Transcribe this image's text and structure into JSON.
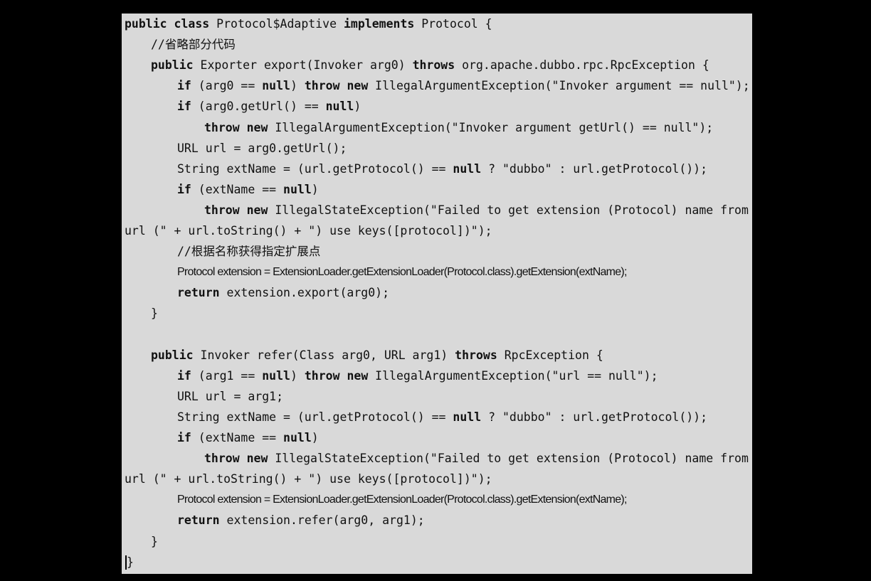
{
  "code": {
    "lines": [
      {
        "indent": 0,
        "segments": [
          {
            "t": "public class",
            "kw": true
          },
          {
            "t": " Protocol$Adaptive "
          },
          {
            "t": "implements",
            "kw": true
          },
          {
            "t": " Protocol {"
          }
        ]
      },
      {
        "indent": 1,
        "segments": [
          {
            "t": "//省略部分代码"
          }
        ]
      },
      {
        "indent": 1,
        "segments": [
          {
            "t": "public",
            "kw": true
          },
          {
            "t": " Exporter export(Invoker arg0) "
          },
          {
            "t": "throws",
            "kw": true
          },
          {
            "t": " org.apache.dubbo.rpc.RpcException {"
          }
        ]
      },
      {
        "indent": 2,
        "segments": [
          {
            "t": "if",
            "kw": true
          },
          {
            "t": " (arg0 == "
          },
          {
            "t": "null",
            "kw": true
          },
          {
            "t": ") "
          },
          {
            "t": "throw new",
            "kw": true
          },
          {
            "t": " IllegalArgumentException(\"Invoker argument == null\");"
          }
        ]
      },
      {
        "indent": 2,
        "segments": [
          {
            "t": "if",
            "kw": true
          },
          {
            "t": " (arg0.getUrl() == "
          },
          {
            "t": "null",
            "kw": true
          },
          {
            "t": ")"
          }
        ]
      },
      {
        "indent": 3,
        "segments": [
          {
            "t": "throw new",
            "kw": true
          },
          {
            "t": " IllegalArgumentException(\"Invoker argument getUrl() == null\");"
          }
        ]
      },
      {
        "indent": 2,
        "segments": [
          {
            "t": "URL url = arg0.getUrl();"
          }
        ]
      },
      {
        "indent": 2,
        "segments": [
          {
            "t": "String extName = (url.getProtocol() == "
          },
          {
            "t": "null",
            "kw": true
          },
          {
            "t": " ? \"dubbo\" : url.getProtocol());"
          }
        ]
      },
      {
        "indent": 2,
        "segments": [
          {
            "t": "if",
            "kw": true
          },
          {
            "t": " (extName == "
          },
          {
            "t": "null",
            "kw": true
          },
          {
            "t": ")"
          }
        ]
      },
      {
        "indent": 3,
        "segments": [
          {
            "t": "throw new",
            "kw": true
          },
          {
            "t": " IllegalStateException(\"Failed to get extension (Protocol) name from"
          }
        ]
      },
      {
        "indent": 0,
        "segments": [
          {
            "t": "url (\" + url.toString() + \") use keys([protocol])\");"
          }
        ]
      },
      {
        "indent": 2,
        "segments": [
          {
            "t": "//根据名称获得指定扩展点"
          }
        ]
      },
      {
        "indent": 2,
        "prop": true,
        "segments": [
          {
            "t": "Protocol extension = ExtensionLoader.getExtensionLoader(Protocol.class).getExtension(extName);"
          }
        ]
      },
      {
        "indent": 2,
        "segments": [
          {
            "t": "return",
            "kw": true
          },
          {
            "t": " extension.export(arg0);"
          }
        ]
      },
      {
        "indent": 1,
        "segments": [
          {
            "t": "}"
          }
        ]
      },
      {
        "indent": 0,
        "segments": []
      },
      {
        "indent": 1,
        "segments": [
          {
            "t": "public",
            "kw": true
          },
          {
            "t": " Invoker refer(Class arg0, URL arg1) "
          },
          {
            "t": "throws",
            "kw": true
          },
          {
            "t": " RpcException {"
          }
        ]
      },
      {
        "indent": 2,
        "segments": [
          {
            "t": "if",
            "kw": true
          },
          {
            "t": " (arg1 == "
          },
          {
            "t": "null",
            "kw": true
          },
          {
            "t": ") "
          },
          {
            "t": "throw new",
            "kw": true
          },
          {
            "t": " IllegalArgumentException(\"url == null\");"
          }
        ]
      },
      {
        "indent": 2,
        "segments": [
          {
            "t": "URL url = arg1;"
          }
        ]
      },
      {
        "indent": 2,
        "segments": [
          {
            "t": "String extName = (url.getProtocol() == "
          },
          {
            "t": "null",
            "kw": true
          },
          {
            "t": " ? \"dubbo\" : url.getProtocol());"
          }
        ]
      },
      {
        "indent": 2,
        "segments": [
          {
            "t": "if",
            "kw": true
          },
          {
            "t": " (extName == "
          },
          {
            "t": "null",
            "kw": true
          },
          {
            "t": ")"
          }
        ]
      },
      {
        "indent": 3,
        "segments": [
          {
            "t": "throw new",
            "kw": true
          },
          {
            "t": " IllegalStateException(\"Failed to get extension (Protocol) name from"
          }
        ]
      },
      {
        "indent": 0,
        "segments": [
          {
            "t": "url (\" + url.toString() + \") use keys([protocol])\");"
          }
        ]
      },
      {
        "indent": 2,
        "prop": true,
        "segments": [
          {
            "t": "Protocol extension = ExtensionLoader.getExtensionLoader(Protocol.class).getExtension(extName);"
          }
        ]
      },
      {
        "indent": 2,
        "segments": [
          {
            "t": "return",
            "kw": true
          },
          {
            "t": " extension.refer(arg0, arg1);"
          }
        ]
      },
      {
        "indent": 1,
        "segments": [
          {
            "t": "}"
          }
        ]
      },
      {
        "indent": 0,
        "cursor": true,
        "segments": [
          {
            "t": "}"
          }
        ]
      }
    ]
  }
}
